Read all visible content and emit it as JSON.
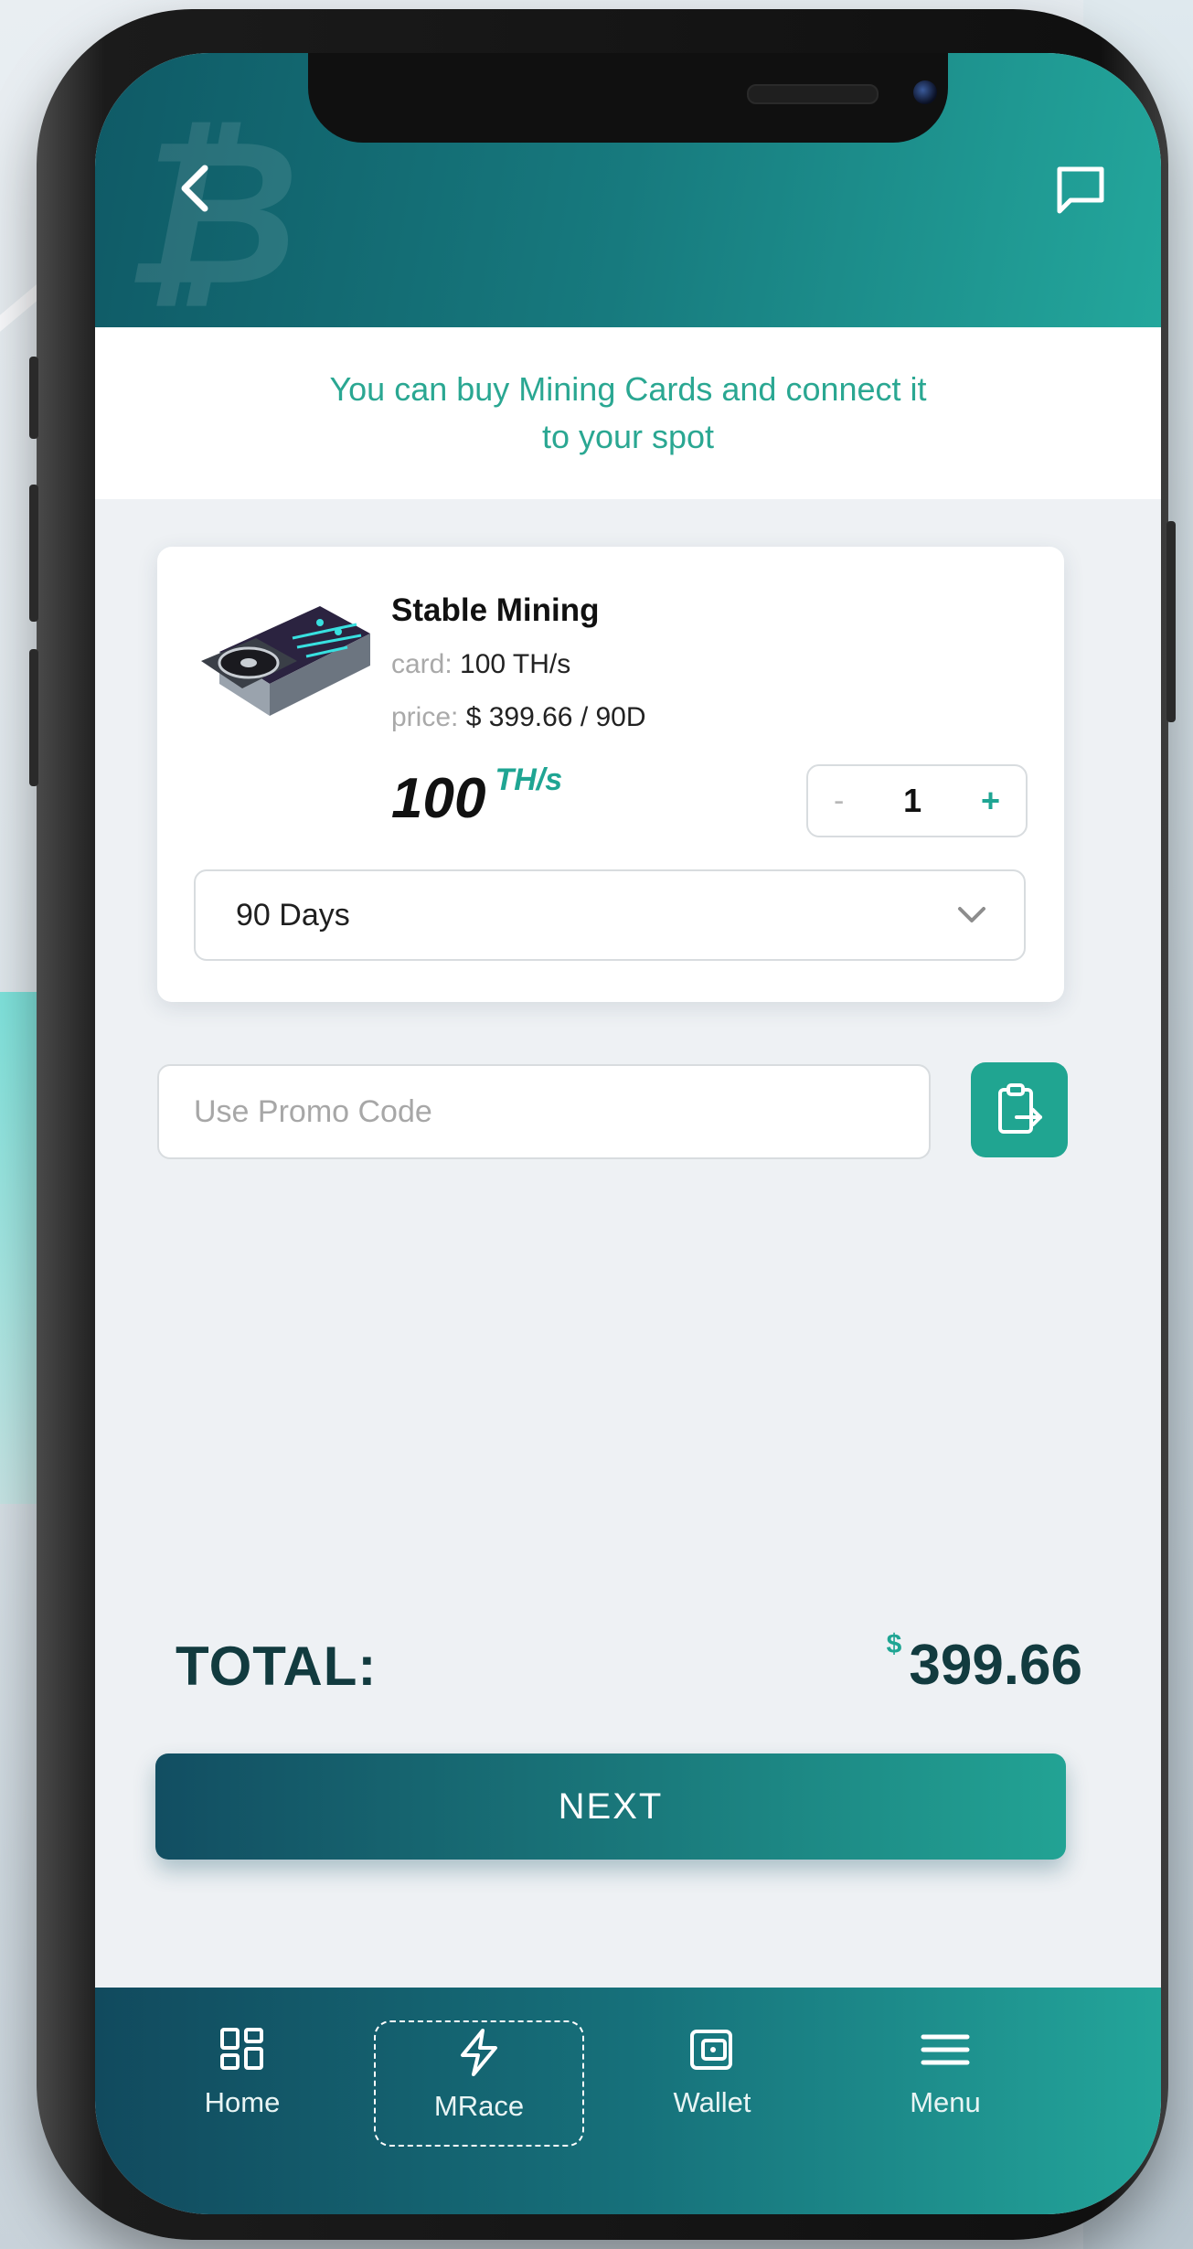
{
  "header": {
    "back_icon": "chevron-left-icon",
    "chat_icon": "chat-bubble-icon",
    "logo": "bitcoin-logo"
  },
  "banner": {
    "line1": "You can buy Mining Cards and connect it",
    "line2": "to your spot"
  },
  "product": {
    "title": "Stable Mining",
    "card_label": "card:",
    "card_value": "100 TH/s",
    "price_label": "price:",
    "price_value": "$ 399.66 / 90D",
    "rate_value": "100",
    "rate_unit": "TH/s",
    "quantity": {
      "minus": "-",
      "value": "1",
      "plus": "+"
    },
    "duration": {
      "selected": "90 Days"
    }
  },
  "promo": {
    "placeholder": "Use Promo Code",
    "button_icon": "clipboard-paste-icon"
  },
  "total": {
    "label": "TOTAL:",
    "currency": "$",
    "amount": "399.66"
  },
  "next_button": "NEXT",
  "bottom_nav": {
    "items": [
      {
        "label": "Home",
        "icon": "grid-icon"
      },
      {
        "label": "MRace",
        "icon": "lightning-icon"
      },
      {
        "label": "Wallet",
        "icon": "wallet-icon"
      },
      {
        "label": "Menu",
        "icon": "hamburger-menu-icon"
      }
    ],
    "active": "MRace"
  },
  "colors": {
    "accent": "#20a591",
    "header_dark": "#0f5a66",
    "text_dark": "#123b3f"
  }
}
